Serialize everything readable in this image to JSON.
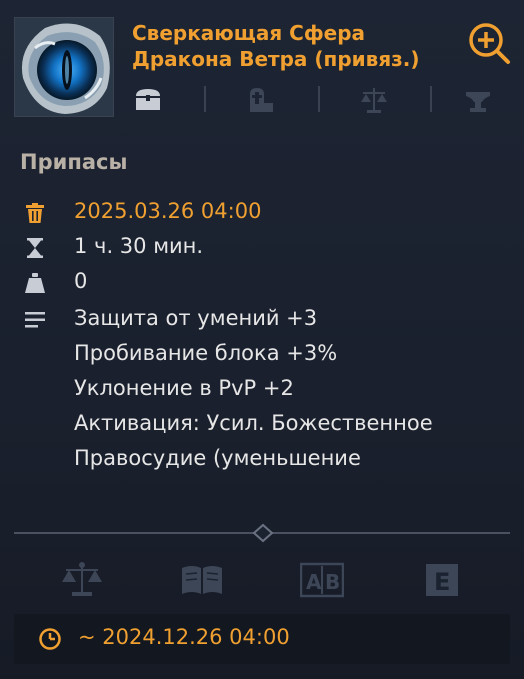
{
  "item": {
    "title_line1": "Сверкающая Сфера",
    "title_line2": "Дракона Ветра (привяз.)",
    "title_color": "#f0a030",
    "icon": "dragon-eye-orb-icon"
  },
  "header": {
    "zoom_icon": "zoom-in-icon",
    "meta_icons": [
      "storage-chest-icon",
      "grave-weight-icon",
      "scales-icon",
      "anvil-icon"
    ]
  },
  "section": {
    "title": "Припасы"
  },
  "details": {
    "expiry_date": "2025.03.26 04:00",
    "duration": "1 ч. 30 мин.",
    "weight": "0",
    "effects": [
      "Защита от умений +3",
      "Пробивание блока +3%",
      "Уклонение в PvP +2",
      "Активация: Усил. Божественное",
      "Правосудие (уменьшение"
    ],
    "icons": [
      "trash-icon",
      "hourglass-icon",
      "weight-icon",
      "description-icon"
    ]
  },
  "bottom_bar": {
    "icons": [
      "scales-icon",
      "open-book-icon",
      "ab-compare-icon",
      "e-key-icon"
    ],
    "e_key_label": "E",
    "ab_label": "A|B"
  },
  "footer": {
    "date": "~ 2024.12.26 04:00",
    "icon": "clock-icon"
  },
  "colors": {
    "accent": "#f0a030",
    "background": "#1b2230",
    "text": "#e6e6e6",
    "muted": "#b9b0a6",
    "dim_icon": "#3d4656"
  }
}
